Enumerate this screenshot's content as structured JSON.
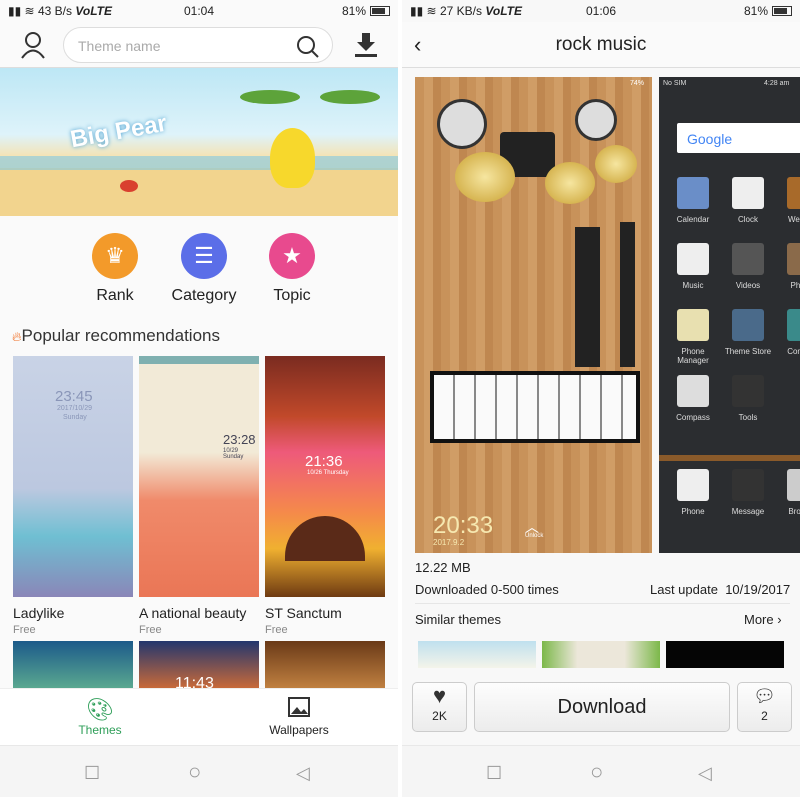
{
  "left": {
    "status": {
      "network": "43 B/s",
      "volte": "VoLTE",
      "time": "01:04",
      "battery": "81%",
      "battery_level": 0.81
    },
    "header": {
      "search_placeholder": "Theme name"
    },
    "banner": {
      "text": "Big Pear"
    },
    "categories": [
      {
        "label": "Rank",
        "color": "#f39a2a",
        "icon": "crown-icon"
      },
      {
        "label": "Category",
        "color": "#5b6ee8",
        "icon": "list-icon"
      },
      {
        "label": "Topic",
        "color": "#e84a8e",
        "icon": "star-icon"
      }
    ],
    "section_title": "Popular recommendations",
    "themes": [
      {
        "name": "Ladylike",
        "price": "Free",
        "clock": "23:45",
        "date": "2017/10/29",
        "day": "Sunday"
      },
      {
        "name": "A national beauty",
        "price": "Free",
        "clock": "23:28",
        "date": "10/29 Sunday"
      },
      {
        "name": "ST Sanctum",
        "price": "Free",
        "clock": "21:36",
        "date": "10/26 Thursday"
      }
    ],
    "row2_clock": "11:43",
    "bottom_nav": [
      {
        "label": "Themes",
        "active": true
      },
      {
        "label": "Wallpapers",
        "active": false
      }
    ],
    "accent": "#2e9e58"
  },
  "right": {
    "status": {
      "network": "27 KB/s",
      "volte": "VoLTE",
      "time": "01:06",
      "battery": "81%",
      "battery_level": 0.81
    },
    "header": {
      "title": "rock music"
    },
    "preview_lock": {
      "battery": "74%",
      "clock": "20:33",
      "date": "2017.9.2",
      "unlock": "Unlock"
    },
    "preview_home": {
      "carrier": "No SIM",
      "time": "4:28 am",
      "search": "Google",
      "apps": [
        "Calendar",
        "Clock",
        "Weather",
        "Music",
        "Videos",
        "Photos",
        "Phone Manager",
        "Theme Store",
        "Contacts",
        "Compass",
        "Tools"
      ],
      "dock": [
        "Phone",
        "Message",
        "Browser"
      ]
    },
    "size": "12.22 MB",
    "downloads": "Downloaded 0-500 times",
    "last_update_label": "Last update",
    "last_update": "10/19/2017",
    "similar_label": "Similar themes",
    "more_label": "More",
    "likes": "2K",
    "download_label": "Download",
    "comments": "2"
  }
}
